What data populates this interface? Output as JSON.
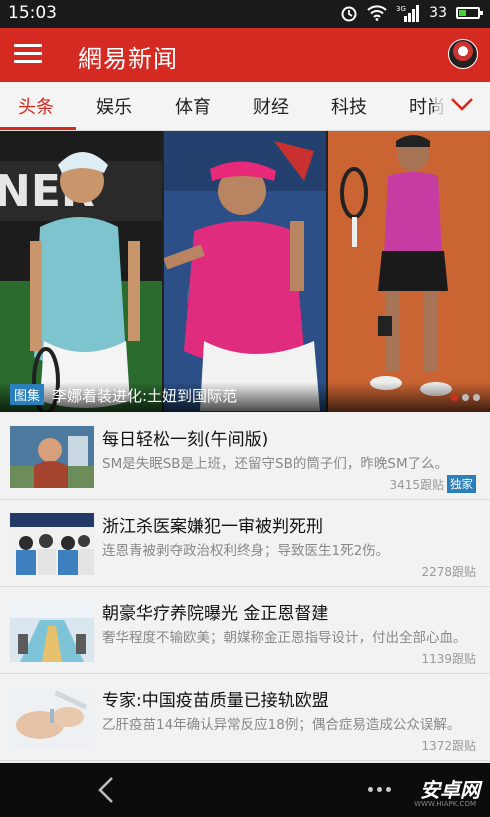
{
  "status": {
    "time": "15:03",
    "signal_label": "3G",
    "battery": "33",
    "battery_level": 0.33
  },
  "appbar": {
    "title": "網易新闻"
  },
  "tabs": [
    {
      "label": "头条",
      "active": true
    },
    {
      "label": "娱乐"
    },
    {
      "label": "体育"
    },
    {
      "label": "财经"
    },
    {
      "label": "科技"
    },
    {
      "label": "时尚"
    }
  ],
  "hero": {
    "badge": "图集",
    "caption": "李娜着装进化:土妞到国际范",
    "dots": 3,
    "active_dot": 0
  },
  "news": [
    {
      "headline": "每日轻松一刻(午间版)",
      "summary": "SM是失眠SB是上班，还留守SB的筒子们，昨晚SM了么。",
      "count": "3415跟贴",
      "tag": "独家"
    },
    {
      "headline": "浙江杀医案嫌犯一审被判死刑",
      "summary": "连恩青被剥夺政治权利终身；导致医生1死2伤。",
      "count": "2278跟贴"
    },
    {
      "headline": "朝豪华疗养院曝光 金正恩督建",
      "summary": "奢华程度不输欧美；朝媒称金正恩指导设计，付出全部心血。",
      "count": "1139跟贴"
    },
    {
      "headline": "专家:中国疫苗质量已接轨欧盟",
      "summary": "乙肝疫苗14年确认异常反应18例；偶合症易造成公众误解。",
      "count": "1372跟贴"
    }
  ],
  "watermark": {
    "text": "安卓网",
    "sub": "WWW.HIAPK.COM"
  },
  "colors": {
    "brand_red": "#d42a21",
    "tag_blue": "#2c7fb8"
  }
}
